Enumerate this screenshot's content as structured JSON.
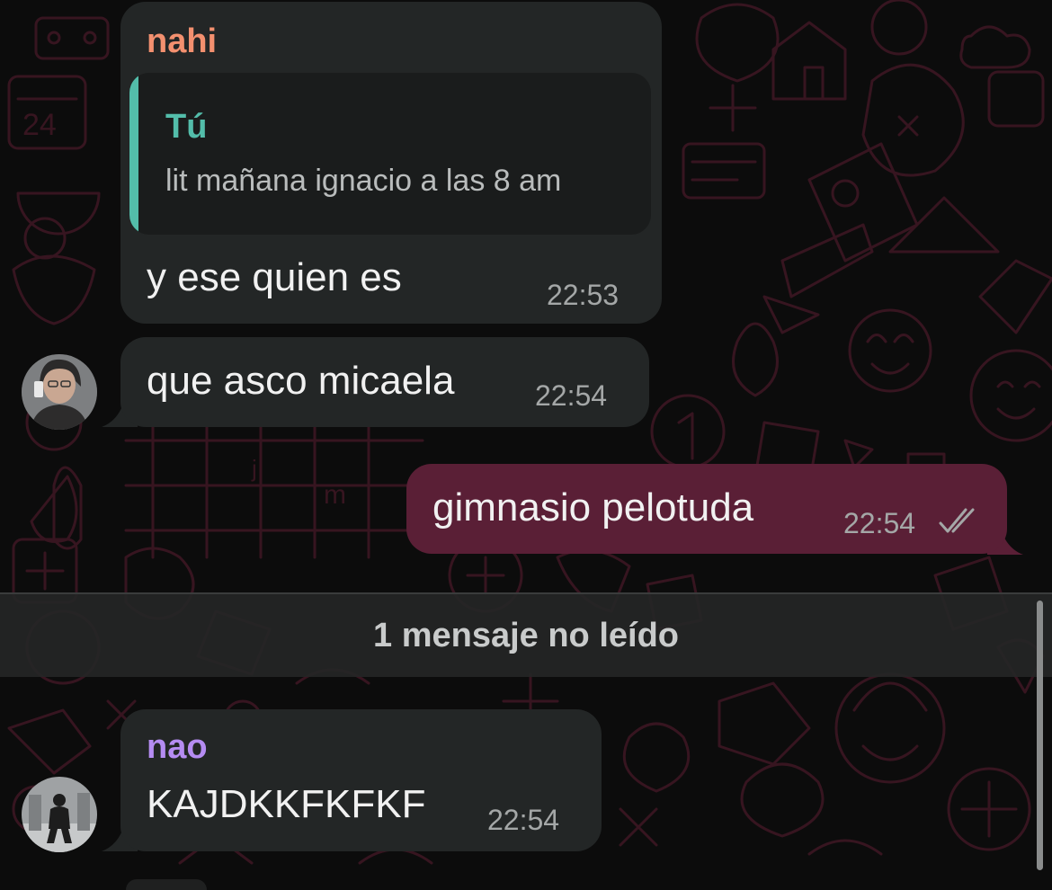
{
  "colors": {
    "background": "#0c0c0c",
    "doodle": "#3a1622",
    "incoming_bubble": "#232626",
    "outgoing_bubble": "#5a1f36",
    "sender_nahi": "#f3906f",
    "sender_nao": "#b58cf2",
    "quote_accent": "#53bdaa",
    "timestamp": "#a4a7a7",
    "read_ticks": "#a4a7a7"
  },
  "messages": [
    {
      "direction": "incoming",
      "sender": "nahi",
      "quoted": {
        "author": "Tú",
        "text": "lit mañana ignacio a las 8 am"
      },
      "text": "y ese quien es",
      "time": "22:53"
    },
    {
      "direction": "incoming",
      "sender": "",
      "avatar_icon": "contact-photo-icon",
      "text": "que asco micaela",
      "time": "22:54"
    },
    {
      "direction": "outgoing",
      "text": "gimnasio pelotuda",
      "time": "22:54",
      "status_icon": "double-check-icon"
    },
    {
      "direction": "incoming",
      "sender": "nao",
      "avatar_icon": "contact-photo-icon",
      "text": "KAJDKKFKFKF",
      "time": "22:54"
    }
  ],
  "unread_divider": {
    "label": "1 mensaje no leído"
  }
}
